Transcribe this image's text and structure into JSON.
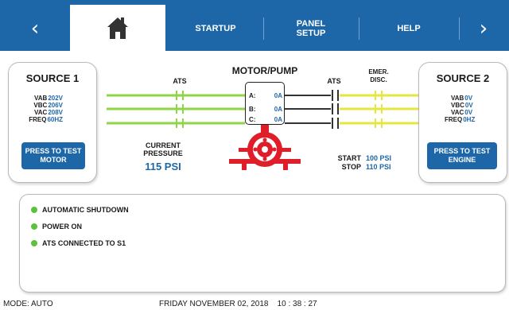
{
  "nav": {
    "back_icon": "chevron-left-icon",
    "home_icon": "house-icon",
    "tabs": [
      {
        "label": "STARTUP"
      },
      {
        "label": "PANEL SETUP"
      },
      {
        "label": "HELP"
      }
    ],
    "next_icon": "chevron-right-icon",
    "active_color": "#ffffff",
    "bar_color": "#1d67a8"
  },
  "source1": {
    "title": "SOURCE 1",
    "readings": [
      {
        "label": "VAB",
        "value": "202V"
      },
      {
        "label": "VBC",
        "value": "206V"
      },
      {
        "label": "VAC",
        "value": "208V"
      },
      {
        "label": "FREQ",
        "value": "60HZ"
      }
    ],
    "button": "PRESS TO TEST MOTOR"
  },
  "source2": {
    "title": "SOURCE 2",
    "readings": [
      {
        "label": "VAB",
        "value": "0V"
      },
      {
        "label": "VBC",
        "value": "0V"
      },
      {
        "label": "VAC",
        "value": "0V"
      },
      {
        "label": "FREQ",
        "value": "0HZ"
      }
    ],
    "button": "PRESS TO TEST ENGINE"
  },
  "diagram": {
    "ats_left": "ATS",
    "motor_title": "MOTOR/PUMP",
    "ats_right": "ATS",
    "emer_disc": "EMER. DISC.",
    "phases": [
      {
        "label": "A:",
        "value": "0A"
      },
      {
        "label": "B:",
        "value": "0A"
      },
      {
        "label": "C:",
        "value": "0A"
      }
    ],
    "current_pressure_label": "CURRENT PRESSURE",
    "current_pressure_value": "115 PSI",
    "start_label": "START",
    "start_value": "100 PSI",
    "stop_label": "STOP",
    "stop_value": "110 PSI",
    "line_color_source1": "#8ed645",
    "line_color_source2": "#e6e640",
    "pump_color": "#e01e2a"
  },
  "status": {
    "items": [
      {
        "label": "AUTOMATIC SHUTDOWN"
      },
      {
        "label": "POWER ON"
      },
      {
        "label": "ATS CONNECTED TO S1"
      }
    ],
    "indicator_color": "#5cc23b"
  },
  "footer": {
    "mode": "MODE: AUTO",
    "datetime": "FRIDAY NOVEMBER 02, 2018    10 : 38 : 27"
  }
}
